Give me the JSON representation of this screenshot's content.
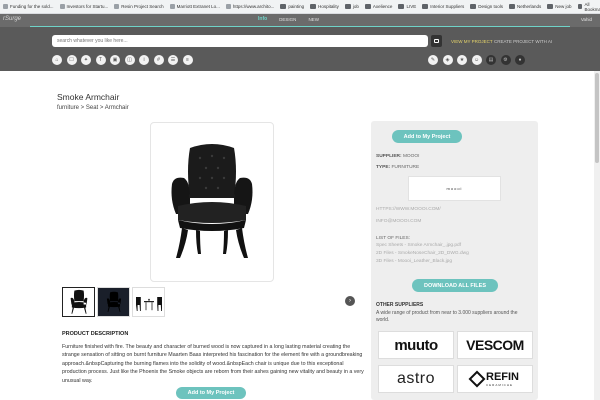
{
  "bookmarks": [
    {
      "label": "Funding for the sold...",
      "type": "site"
    },
    {
      "label": "Investors for Startu...",
      "type": "site"
    },
    {
      "label": "Resin Project Search",
      "type": "site"
    },
    {
      "label": "Marriott Extranet Lo...",
      "type": "site"
    },
    {
      "label": "https://www.archito...",
      "type": "site"
    },
    {
      "label": "painting",
      "type": "folder"
    },
    {
      "label": "Hospitality",
      "type": "folder"
    },
    {
      "label": "job",
      "type": "folder"
    },
    {
      "label": "Axelience",
      "type": "folder"
    },
    {
      "label": "LIVE",
      "type": "folder"
    },
    {
      "label": "Interior Suppliers",
      "type": "folder"
    },
    {
      "label": "Design tools",
      "type": "folder"
    },
    {
      "label": "Netherlands",
      "type": "folder"
    },
    {
      "label": "New job",
      "type": "folder"
    }
  ],
  "all_bookmarks": "All Bookmarks",
  "app": {
    "logo": "rSurge",
    "nav": [
      "Info",
      "DESIGN",
      "NEW"
    ],
    "user": "Vahid"
  },
  "search": {
    "placeholder": "search whatever you like here...",
    "view_project": "VIEW MY PROJECT",
    "create_project": "CREATE PROJECT WITH AI"
  },
  "toolbar_icons_left": [
    "home-icon",
    "sofa-icon",
    "lamp-icon",
    "text-icon",
    "box-icon",
    "image-icon",
    "info-icon",
    "grid-icon",
    "list-icon",
    "layers-icon"
  ],
  "toolbar_icon_glyphs_left": [
    "⌂",
    "☐",
    "✦",
    "T",
    "▣",
    "◫",
    "i",
    "#",
    "☰",
    "≡"
  ],
  "toolbar_icons_right": [
    "pencil-icon",
    "tag-icon",
    "star-icon",
    "user-icon",
    "cart-icon",
    "gear-icon",
    "settings-icon"
  ],
  "toolbar_icon_glyphs_right": [
    "✎",
    "◈",
    "★",
    "☺",
    "▤",
    "⚙",
    "●"
  ],
  "product": {
    "title": "Smoke Armchair",
    "breadcrumb": "furniture > Seat > Armchair",
    "description_heading": "PRODUCT DESCRIPTION",
    "description": "Furniture finished with fire. The beauty and character of burned wood is now captured in a long lasting material creating the strange sensation of sitting on burnt furniture Maarten Baas interpreted his fascination for the element fire with a groundbreaking approach.&nbspCapturing the burning flames into the solidity of wood.&nbspEach chair is unique due to this exceptional production process. Just like the Phoenix the Smoke objects are reborn from their ashes gaining new vitality and beauty in a very unusual way.",
    "add_button": "Add to My Project"
  },
  "panel": {
    "add_button": "Add to My Project",
    "supplier_label": "SUPPLIER:",
    "supplier": "MOOOI",
    "type_label": "TYPE:",
    "type": "FURNITURE",
    "brand_logo": "moooi",
    "website": "HTTPS://WWW.MOOOI.COM/",
    "email": "INFO@MOOOI.COM",
    "files_label": "LIST OF FILES:",
    "files": [
      "Spec Sheets - Smoke Armchair_.jpg.pdf",
      "2D Files - SmokeNoseChair_2D_DWG.dwg",
      "3D Files - Moooi_Leather_Black.jpg"
    ],
    "download_button": "DOWNLOAD ALL FILES",
    "other_heading": "OTHER SUPPLIERS",
    "other_desc": "A wide range of product from near to 3.000 suppliers around the world.",
    "suppliers": [
      "muuto",
      "VESCOM",
      "astro",
      "REFIN"
    ],
    "refin_sub": "CERAMICHE"
  },
  "colors": {
    "accent": "#6dc3be",
    "header": "#5a5a5a",
    "highlight": "#e6d46a"
  }
}
